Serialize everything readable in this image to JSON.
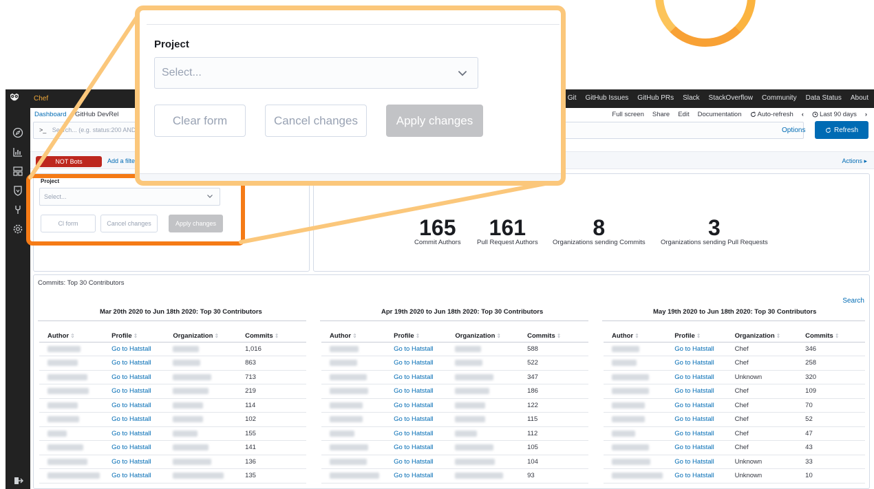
{
  "app": {
    "brand": "Chef"
  },
  "topnav": [
    "Git",
    "GitHub Issues",
    "GitHub PRs",
    "Slack",
    "StackOverflow",
    "Community",
    "Data Status",
    "About"
  ],
  "breadcrumb": {
    "root": "Dashboard",
    "current": "GitHub DevRel"
  },
  "header_actions": {
    "fullscreen": "Full screen",
    "share": "Share",
    "edit": "Edit",
    "documentation": "Documentation",
    "auto_refresh": "Auto-refresh",
    "time_range": "Last 90 days"
  },
  "query": {
    "prompt": ">_",
    "placeholder": "Search... (e.g. status:200 AND",
    "options": "Options",
    "refresh": "Refresh"
  },
  "filters": {
    "not_bots": "NOT Bots",
    "add_filter": "Add a filter",
    "actions": "Actions ▸"
  },
  "project_filter": {
    "label": "Project",
    "placeholder": "Select...",
    "clear": "Clear form",
    "cancel": "Cancel changes",
    "apply": "Apply changes",
    "clear_partial": "Cl     form"
  },
  "metrics": [
    {
      "value": "165",
      "label": "Commit Authors"
    },
    {
      "value": "161",
      "label": "Pull Request Authors"
    },
    {
      "value": "8",
      "label": "Organizations sending Commits"
    },
    {
      "value": "3",
      "label": "Organizations sending Pull Requests"
    }
  ],
  "contributors": {
    "title": "Commits: Top 30 Contributors",
    "search": "Search",
    "columns": {
      "author": "Author",
      "profile": "Profile",
      "organization": "Organization",
      "commits": "Commits"
    },
    "profile_link": "Go to Hatstall",
    "tables": [
      {
        "title": "Mar 20th 2020 to Jun 18th 2020: Top 30 Contributors",
        "rows": [
          {
            "org": "",
            "commits": "1,016"
          },
          {
            "org": "",
            "commits": "863"
          },
          {
            "org": "",
            "commits": "713"
          },
          {
            "org": "",
            "commits": "219"
          },
          {
            "org": "",
            "commits": "114"
          },
          {
            "org": "",
            "commits": "102"
          },
          {
            "org": "",
            "commits": "155"
          },
          {
            "org": "",
            "commits": "141"
          },
          {
            "org": "",
            "commits": "136"
          },
          {
            "org": "",
            "commits": "135"
          }
        ]
      },
      {
        "title": "Apr 19th 2020 to Jun 18th 2020: Top 30 Contributors",
        "rows": [
          {
            "org": "",
            "commits": "588"
          },
          {
            "org": "",
            "commits": "522"
          },
          {
            "org": "",
            "commits": "347"
          },
          {
            "org": "",
            "commits": "186"
          },
          {
            "org": "",
            "commits": "122"
          },
          {
            "org": "",
            "commits": "115"
          },
          {
            "org": "",
            "commits": "112"
          },
          {
            "org": "",
            "commits": "105"
          },
          {
            "org": "",
            "commits": "104"
          },
          {
            "org": "",
            "commits": "93"
          }
        ]
      },
      {
        "title": "May 19th 2020 to Jun 18th 2020: Top 30 Contributors",
        "rows": [
          {
            "org": "Chef",
            "commits": "346"
          },
          {
            "org": "Chef",
            "commits": "258"
          },
          {
            "org": "Unknown",
            "commits": "320"
          },
          {
            "org": "Chef",
            "commits": "109"
          },
          {
            "org": "Chef",
            "commits": "70"
          },
          {
            "org": "Chef",
            "commits": "52"
          },
          {
            "org": "Chef",
            "commits": "47"
          },
          {
            "org": "Chef",
            "commits": "43"
          },
          {
            "org": "Unknown",
            "commits": "33"
          },
          {
            "org": "Unknown",
            "commits": "10"
          }
        ]
      }
    ]
  },
  "colors": {
    "accent": "#006bb4",
    "brand": "#f0a93b",
    "highlight": "#f57b16",
    "callout": "#fbc77b",
    "danger": "#bd271e"
  },
  "icons": [
    "owl-logo-icon",
    "compass-icon",
    "chart-icon",
    "dashboard-icon",
    "shield-icon",
    "wrench-icon",
    "gear-icon",
    "logout-icon",
    "chevron-down-icon",
    "refresh-icon",
    "clock-icon"
  ]
}
